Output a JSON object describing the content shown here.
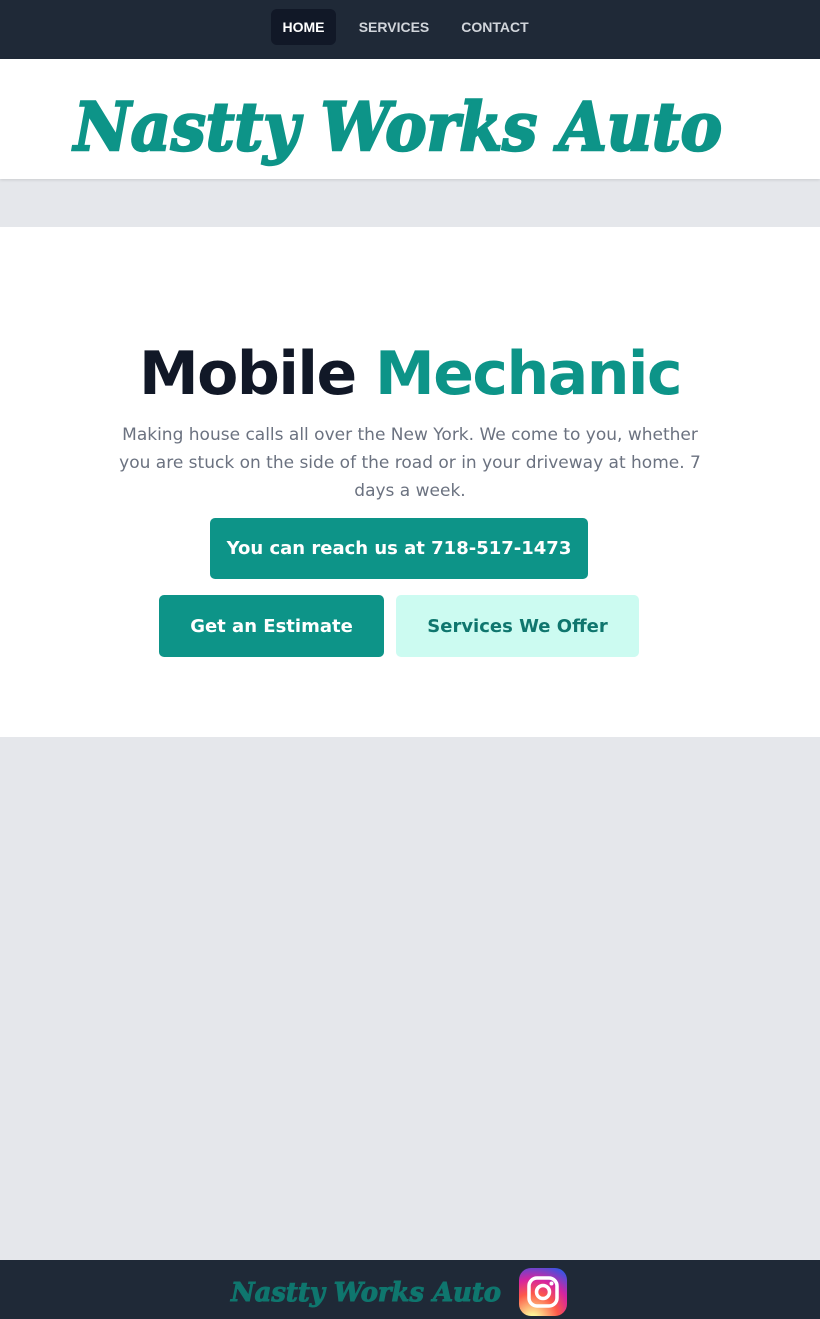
{
  "nav": {
    "items": [
      {
        "label": "HOME",
        "active": true
      },
      {
        "label": "SERVICES",
        "active": false
      },
      {
        "label": "CONTACT",
        "active": false
      }
    ]
  },
  "brand": {
    "name": "Nastty Works Auto",
    "color": "#0d9488"
  },
  "hero": {
    "title_part1": "Mobile",
    "title_part2": "Mechanic",
    "description": "Making house calls all over the New York. We come to you, whether you are stuck on the side of the road or in your driveway at home. 7 days a week.",
    "phone_button": "You can reach us at 718-517-1473",
    "estimate_button": "Get an Estimate",
    "services_button": "Services We Offer"
  },
  "footer": {
    "brand_name": "Nastty Works Auto",
    "brand_color": "#0f766e",
    "social_icon": "instagram-icon"
  },
  "colors": {
    "primary": "#0d9488",
    "dark": "#1f2937",
    "light_accent": "#ccfbf1"
  }
}
